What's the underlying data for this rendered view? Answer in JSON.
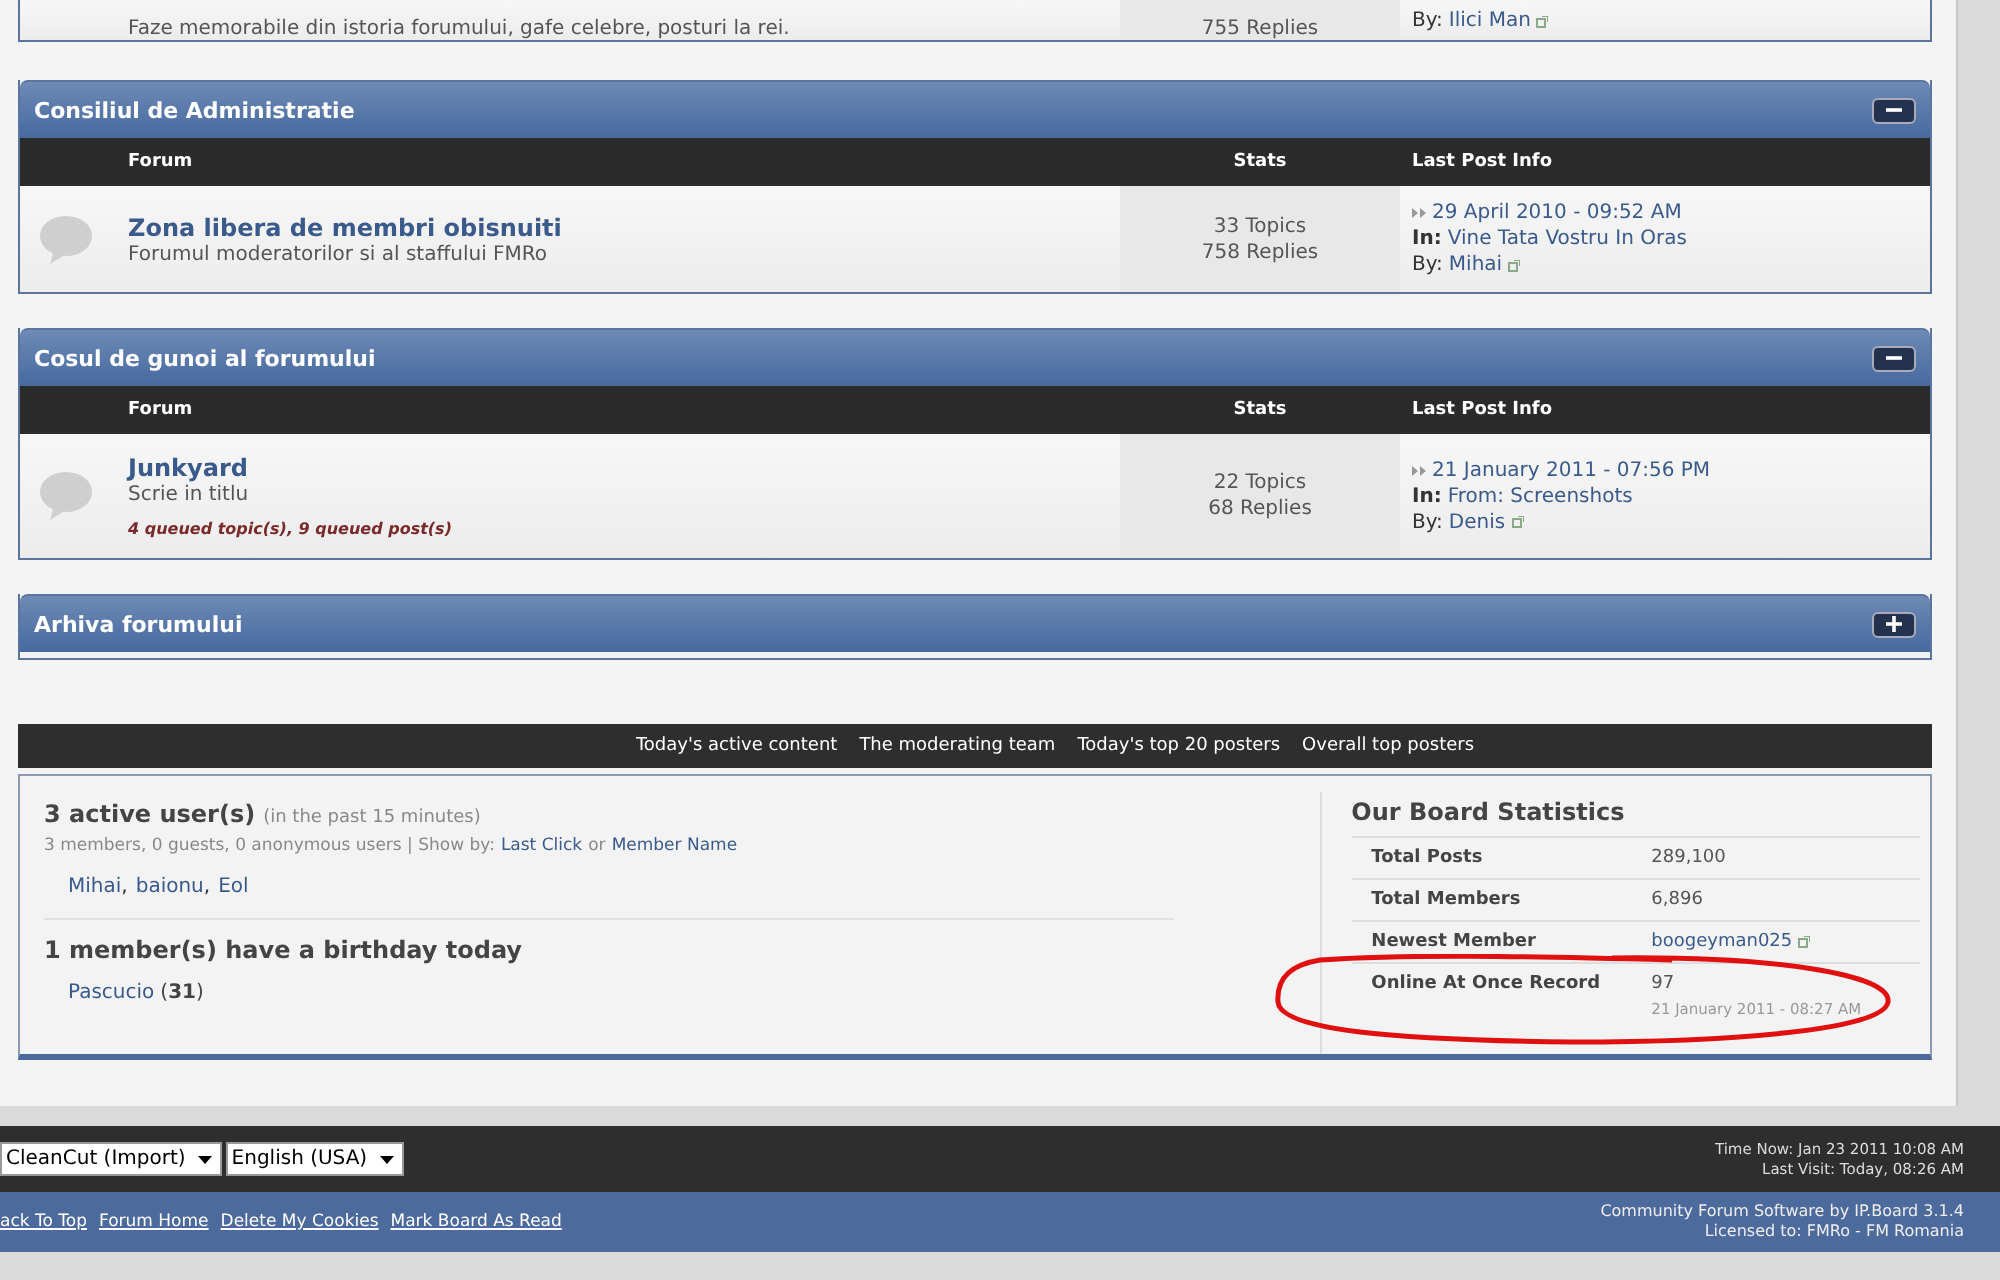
{
  "top_partial_row": {
    "description": "Faze memorabile din istoria forumului, gafe celebre, posturi la rei.",
    "replies": "755 Replies",
    "by_label": "By:",
    "by": "Ilici Man"
  },
  "categories": [
    {
      "title": "Consiliul de Administratie",
      "expanded": true,
      "columns": [
        "Forum",
        "Stats",
        "Last Post Info"
      ],
      "forums": [
        {
          "name": "Zona libera de membri obisnuiti",
          "description": "Forumul moderatorilor si al staffului FMRo",
          "topics": "33 Topics",
          "replies": "758 Replies",
          "last_date": "29 April 2010 - 09:52 AM",
          "in_label": "In:",
          "in": "Vine Tata Vostru In Oras",
          "by_label": "By:",
          "by": "Mihai"
        }
      ]
    },
    {
      "title": "Cosul de gunoi al forumului",
      "expanded": true,
      "columns": [
        "Forum",
        "Stats",
        "Last Post Info"
      ],
      "forums": [
        {
          "name": "Junkyard",
          "description": "Scrie in titlu",
          "queued": "4 queued topic(s), 9 queued post(s)",
          "topics": "22 Topics",
          "replies": "68 Replies",
          "last_date": "21 January 2011 - 07:56 PM",
          "in_label": "In:",
          "in": "From: Screenshots",
          "by_label": "By:",
          "by": "Denis"
        }
      ]
    },
    {
      "title": "Arhiva forumului",
      "expanded": false
    }
  ],
  "stats_links": [
    "Today's active content",
    "The moderating team",
    "Today's top 20 posters",
    "Overall top posters"
  ],
  "active_users": {
    "title": "3 active user(s)",
    "subtitle": "(in the past 15 minutes)",
    "summary": "3 members, 0 guests, 0 anonymous users | Show by:",
    "link1": "Last Click",
    "or": "or",
    "link2": "Member Name",
    "users": [
      "Mihai",
      "baionu",
      "Eol"
    ],
    "separator": ","
  },
  "birthday": {
    "title": "1 member(s) have a birthday today",
    "name": "Pascucio",
    "age": "(**31**)"
  },
  "board_stats": {
    "title": "Our Board Statistics",
    "rows": [
      {
        "label": "Total Posts",
        "value": "289,100"
      },
      {
        "label": "Total Members",
        "value": "6,896"
      },
      {
        "label": "Newest Member",
        "value": "boogeyman025",
        "link": true
      },
      {
        "label": "Online At Once Record",
        "value": "97",
        "note": "21 January 2011 - 08:27 AM"
      }
    ]
  },
  "skin_select": "CleanCut (Import)",
  "language_select": "English (USA)",
  "time_now": "Time Now: Jan 23 2011 10:08 AM",
  "last_visit": "Last Visit: Today, 08:26 AM",
  "footer_links": [
    "ack To Top",
    "Forum Home",
    "Delete My Cookies",
    "Mark Board As Read"
  ],
  "powered_by": "Community Forum Software by IP.Board 3.1.4",
  "licensed": "Licensed to: FMRo - FM Romania"
}
